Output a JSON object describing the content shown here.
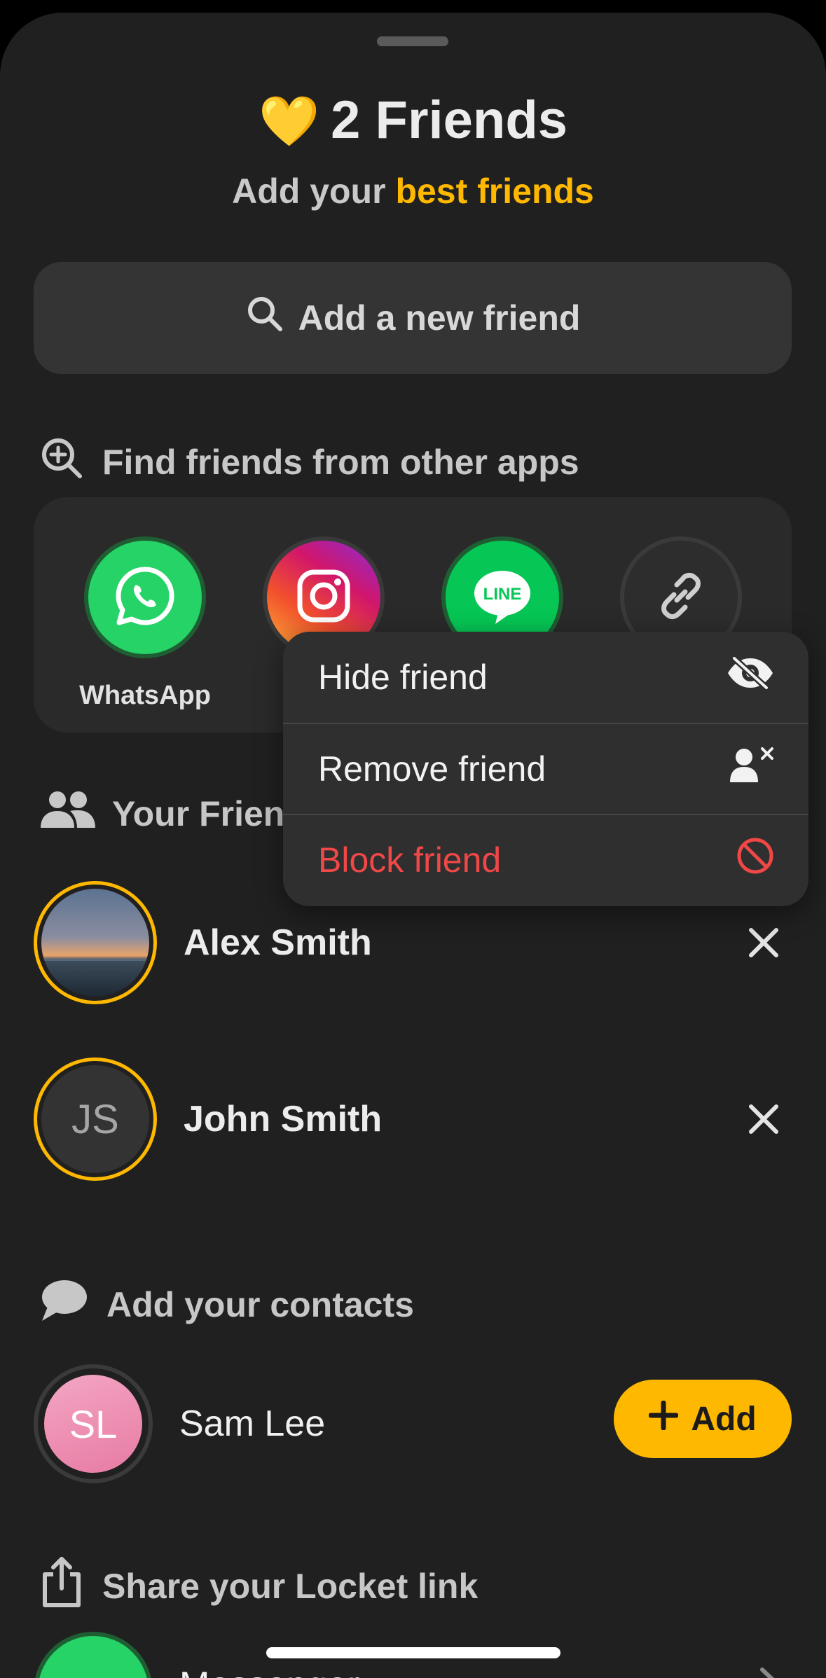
{
  "header": {
    "heart": "💛",
    "title": "2 Friends",
    "subtitle_prefix": "Add your ",
    "subtitle_accent": "best friends"
  },
  "search": {
    "label": "Add a new friend"
  },
  "find_section": {
    "title": "Find friends from other apps",
    "apps": [
      {
        "name": "WhatsApp",
        "icon": "whatsapp-icon",
        "color": "#25d366"
      },
      {
        "name": "Instagram",
        "icon": "instagram-icon"
      },
      {
        "name": "LINE",
        "icon": "line-icon",
        "color": "#06c755"
      },
      {
        "name": "Link",
        "icon": "link-icon"
      }
    ]
  },
  "friends_section": {
    "title": "Your Frien",
    "friends": [
      {
        "name": "Alex Smith",
        "avatar": "photo"
      },
      {
        "name": "John Smith",
        "initials": "JS"
      }
    ]
  },
  "context_menu": {
    "items": [
      {
        "label": "Hide friend",
        "icon": "eye-slash-icon"
      },
      {
        "label": "Remove friend",
        "icon": "remove-person-icon"
      },
      {
        "label": "Block friend",
        "icon": "block-icon",
        "color": "#f04747"
      }
    ]
  },
  "contacts_section": {
    "title": "Add your contacts",
    "contacts": [
      {
        "name": "Sam Lee",
        "initials": "SL"
      }
    ],
    "add_label": "Add"
  },
  "share_section": {
    "title": "Share your Locket link",
    "first_item": "Messenger"
  },
  "colors": {
    "accent": "#ffb800",
    "danger": "#f04747",
    "background": "#202020"
  }
}
